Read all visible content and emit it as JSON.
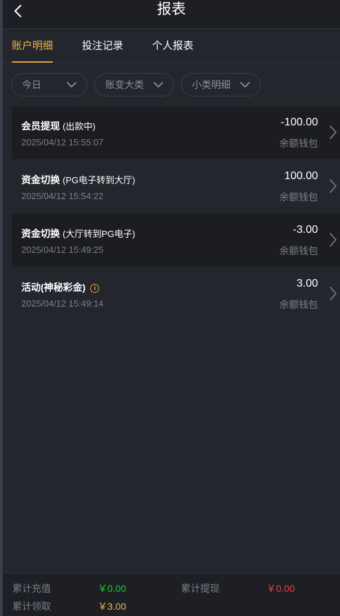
{
  "header": {
    "title": "报表",
    "back_icon": "chevron-left-icon"
  },
  "tabs": [
    {
      "label": "账户明细",
      "active": true
    },
    {
      "label": "投注记录",
      "active": false
    },
    {
      "label": "个人报表",
      "active": false
    }
  ],
  "filters": [
    {
      "label": "今日"
    },
    {
      "label": "账变大类"
    },
    {
      "label": "小类明细"
    }
  ],
  "records": [
    {
      "title": "会员提现",
      "sub": "(出款中)",
      "time": "2025/04/12 15:55:07",
      "amount": "-100.00",
      "wallet": "余额钱包",
      "info": false
    },
    {
      "title": "资金切换",
      "sub": "(PG电子转到大厅)",
      "time": "2025/04/12 15:54:22",
      "amount": "100.00",
      "wallet": "余额钱包",
      "info": false
    },
    {
      "title": "资金切换",
      "sub": "(大厅转到PG电子)",
      "time": "2025/04/12 15:49:25",
      "amount": "-3.00",
      "wallet": "余额钱包",
      "info": false
    },
    {
      "title": "活动(神秘彩金)",
      "sub": "",
      "time": "2025/04/12 15:49:14",
      "amount": "3.00",
      "wallet": "余额钱包",
      "info": true,
      "info_icon": "info-circle-icon"
    }
  ],
  "summary": {
    "deposit_label": "累计充值",
    "deposit_value": "￥0.00",
    "withdraw_label": "累计提现",
    "withdraw_value": "￥0.00",
    "bonus_label": "累计领取",
    "bonus_value": "￥3.00"
  },
  "colors": {
    "accent": "#e5a33c",
    "deposit": "#22c83a",
    "withdraw": "#e84545",
    "bonus": "#f0b84a",
    "background": "#23262d"
  }
}
